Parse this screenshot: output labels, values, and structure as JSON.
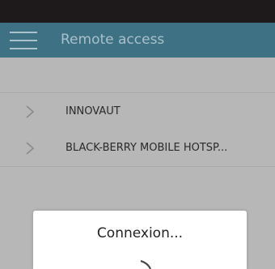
{
  "app_bar": {
    "title": "Remote access",
    "menu_icon": "hamburger-menu-icon"
  },
  "list": {
    "items": [
      {
        "label": "INNOVAUT",
        "icon": "chevron-right-icon"
      },
      {
        "label": "BLACK-BERRY MOBILE HOTSP...",
        "icon": "chevron-right-icon"
      }
    ]
  },
  "dialog": {
    "title": "Connexion...",
    "spinner_icon": "loading-spinner-icon"
  },
  "colors": {
    "status_bar": "#1e1a1b",
    "app_bar": "#3e7184",
    "app_bar_text": "#a7c0ca",
    "overlay_background": "#b7b7b7",
    "dialog_background": "#ffffff"
  }
}
